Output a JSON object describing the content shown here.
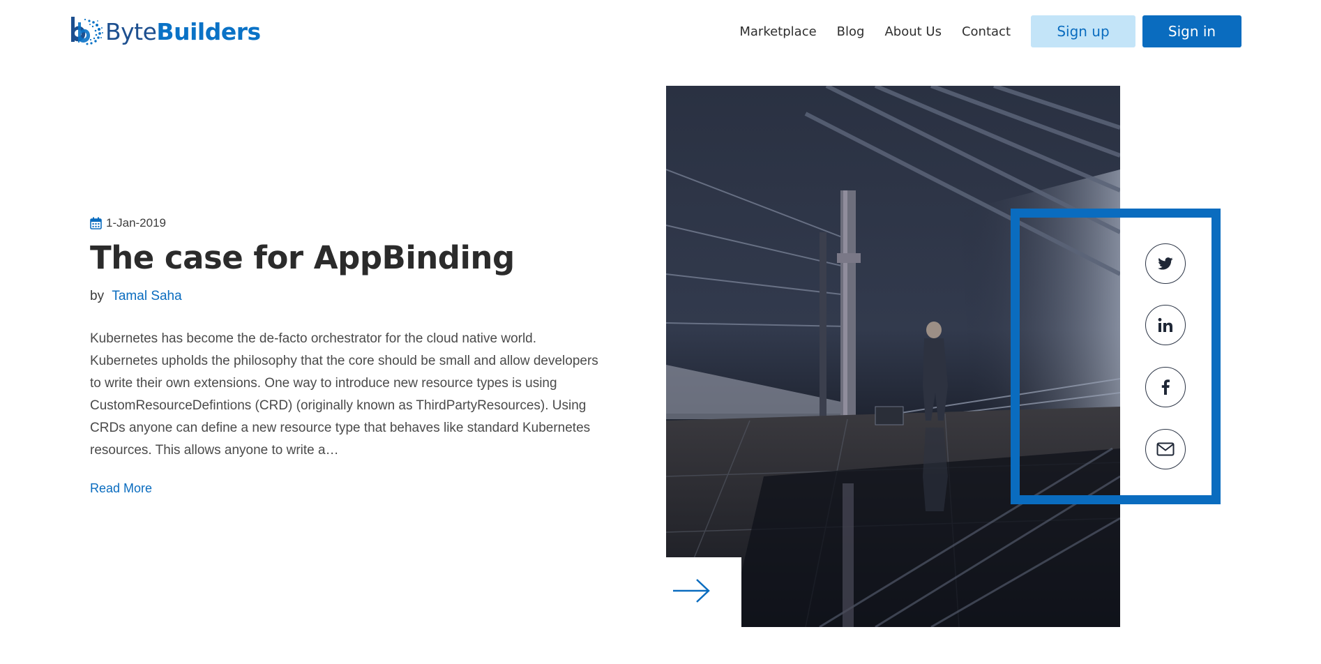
{
  "brand": {
    "name_part1": "Byte",
    "name_part2": "Builders",
    "primary_color": "#0a6cbf",
    "dark_color": "#1d4f8f"
  },
  "nav": {
    "links": [
      "Marketplace",
      "Blog",
      "About Us",
      "Contact"
    ],
    "signup_label": "Sign up",
    "signin_label": "Sign in"
  },
  "post": {
    "date": "1-Jan-2019",
    "title": "The case for AppBinding",
    "by_label": "by",
    "author": "Tamal Saha",
    "excerpt": "Kubernetes has become the de-facto orchestrator for the cloud native world. Kubernetes upholds the philosophy that the core should be small and allow developers to write their own extensions. One way to introduce new resource types is using CustomResourceDefintions (CRD) (originally known as ThirdPartyResources). Using CRDs anyone can define a new resource type that behaves like standard Kubernetes resources. This allows anyone to write a…",
    "read_more_label": "Read More",
    "icons": {
      "date": "calendar-icon",
      "next": "arrow-right-icon"
    }
  },
  "hero_image": {
    "subject": "train-platform-photo"
  },
  "share": {
    "icons": [
      "twitter-icon",
      "linkedin-icon",
      "facebook-icon",
      "email-icon"
    ]
  }
}
